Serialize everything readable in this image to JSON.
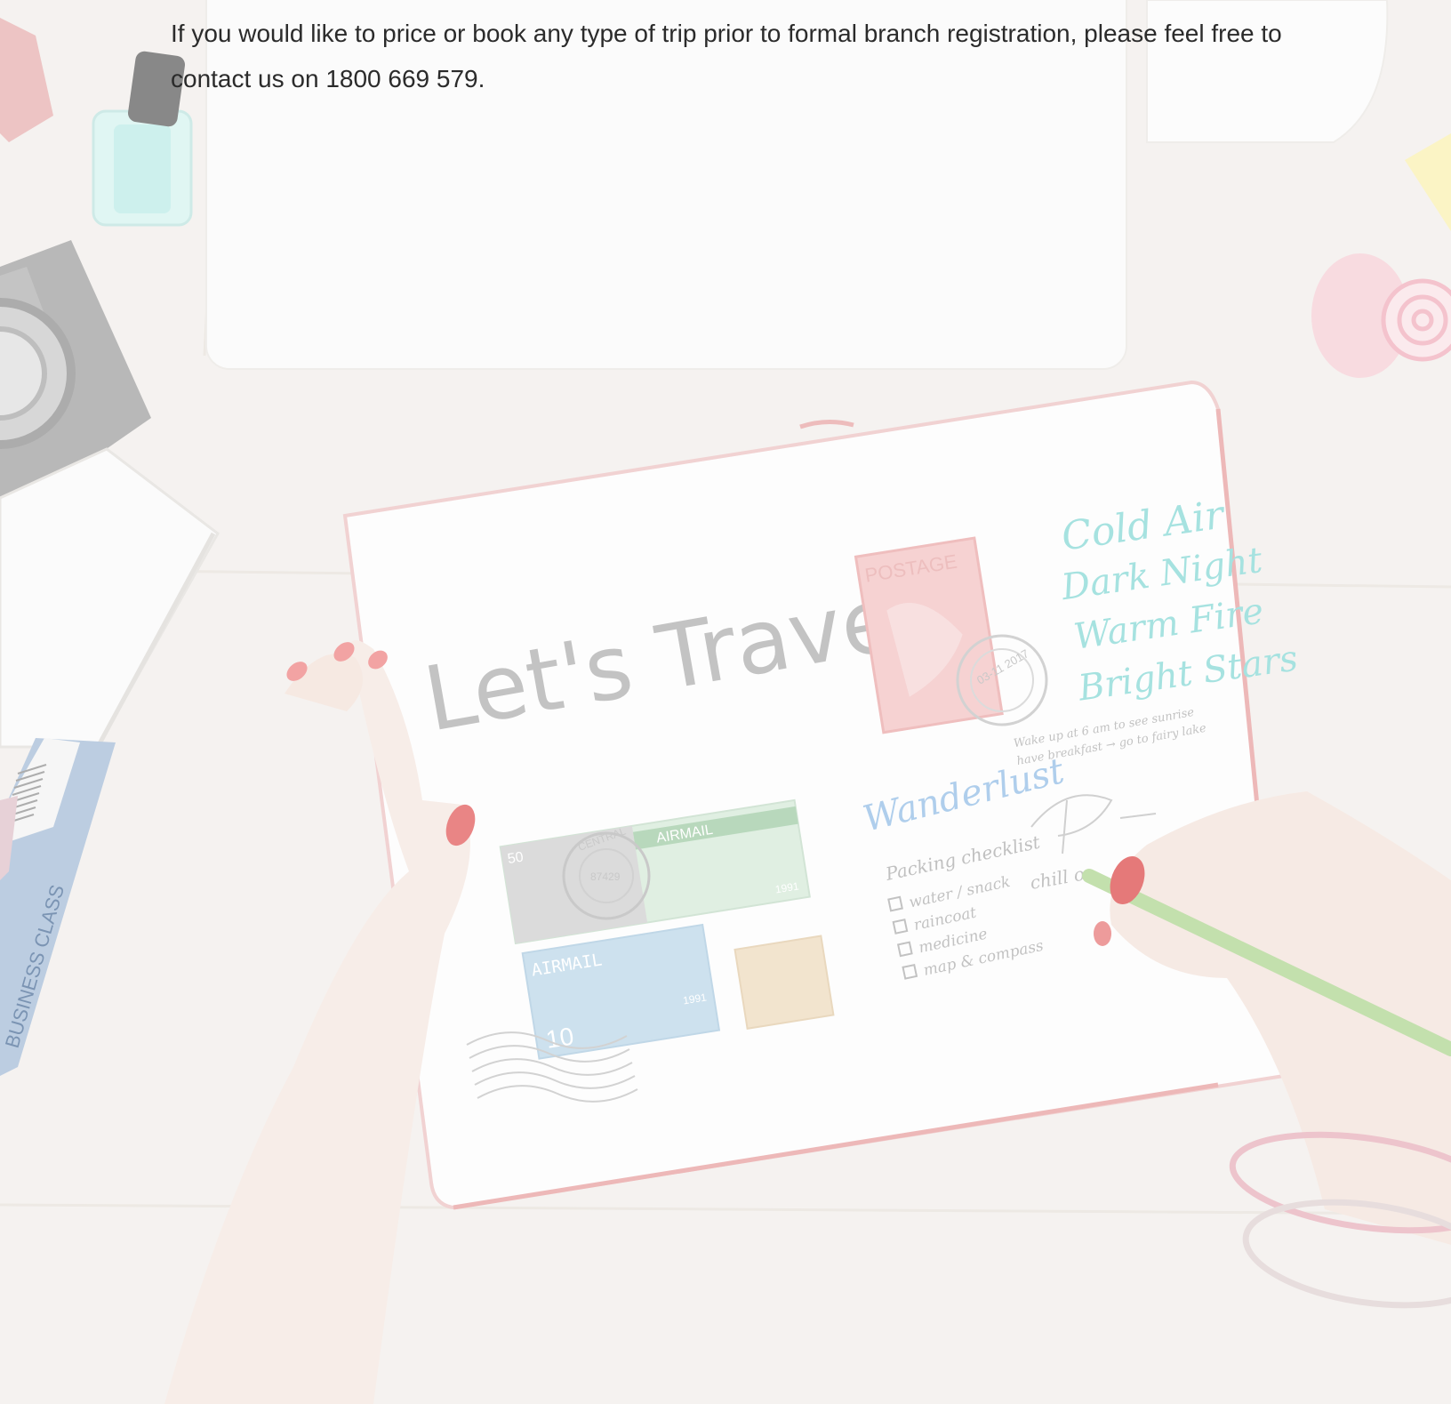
{
  "intro": {
    "text_before": "If you would like to price or book any type of trip prior to formal branch registration, please feel free to contact us on ",
    "phone": "1800 669 579",
    "text_after": "."
  },
  "hero": {
    "headline": "Let's Travel",
    "notebook_script": {
      "poem": [
        "Cold Air",
        "Dark Night",
        "Warm Fire",
        "Bright Stars"
      ],
      "wanderlust": "Wanderlust",
      "packing_title": "Packing checklist",
      "packing_items": [
        "water / snack",
        "raincoat",
        "medicine",
        "map & compass"
      ],
      "plan_notes": [
        "Wake up at 6 am to see sunrise",
        "have breakfast → go to fairy lake"
      ],
      "chill": "chill o..."
    },
    "stamps": {
      "postage_label": "POSTAGE",
      "airmail_label": "AIRMAIL",
      "airmail_green": "AIRMAIL",
      "year": "1991",
      "value_10": "10",
      "value_50": "50",
      "postmark_number": "87429",
      "postmark_central": "CENTRAL",
      "postmark_date": "03-11 2017"
    },
    "ticket_label": "BUSINESS CLASS",
    "colors": {
      "notebook_edge": "#d96a6a",
      "nail": "#d8343c",
      "pencil": "#7ab648",
      "teal_script": "#7fd6d3",
      "blue_script": "#6fa3d6",
      "headline": "#a8a8a8"
    }
  }
}
